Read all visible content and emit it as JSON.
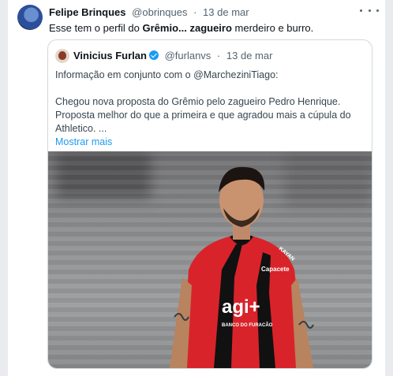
{
  "tweet": {
    "author_name": "Felipe Brinques",
    "author_handle": "@obrinques",
    "separator": "·",
    "date": "13 de mar",
    "text_prefix": "Esse tem o perfil do ",
    "text_bold": "Grêmio... zagueiro",
    "text_suffix": " merdeiro e burro."
  },
  "quote": {
    "author_name": "Vinicius Furlan",
    "author_handle": "@furlanvs",
    "separator": "·",
    "date": "13 de mar",
    "line1": "Informação em conjunto com o @MarcheziniTiago:",
    "line2": "Chegou nova proposta do Grêmio pelo zagueiro Pedro Henrique.",
    "line3": "Proposta melhor do que a primeira e que agradou mais a cúpula do",
    "line4": "Athletico. ...",
    "show_more": "Mostrar mais"
  },
  "jersey": {
    "sponsor_top": "Capacete",
    "sponsor_main": "agi+",
    "sponsor_sub": "BANCO DO FURACÃO",
    "sleeve": "KAYAN"
  },
  "icons": {
    "more": "more-dots-icon",
    "verified": "verified-badge-icon"
  },
  "colors": {
    "verified": "#1d9bf0",
    "link": "#1d9bf0",
    "jersey_red": "#d9232a"
  }
}
